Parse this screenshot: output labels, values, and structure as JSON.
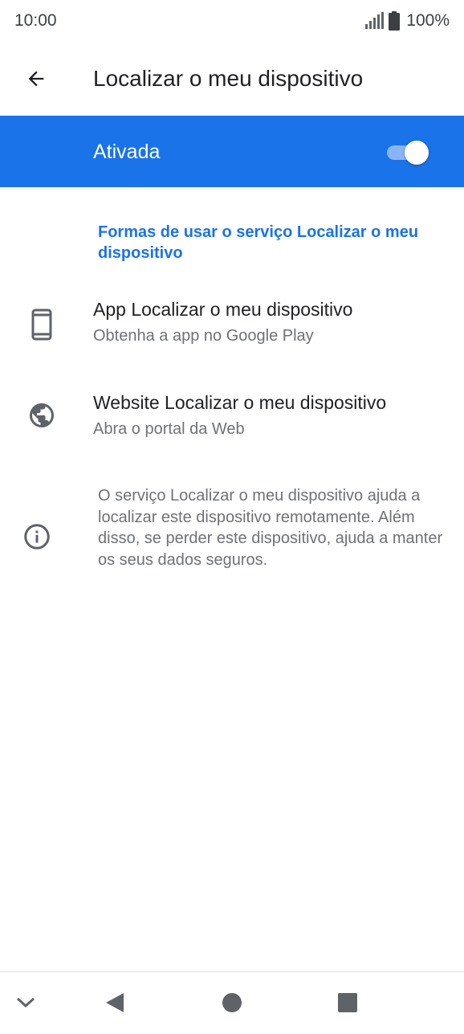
{
  "status_bar": {
    "time": "10:00",
    "battery": "100%",
    "icons": [
      "signal-icon",
      "battery-icon"
    ]
  },
  "toolbar": {
    "back_icon": "arrow-back-icon",
    "title": "Localizar o meu dispositivo"
  },
  "master_switch": {
    "label": "Ativada",
    "checked": true,
    "bar_color": "#1a73e8"
  },
  "section": {
    "header": "Formas de usar o serviço Localizar o meu dispositivo",
    "items": [
      {
        "icon": "phone-icon",
        "title": "App Localizar o meu dispositivo",
        "subtitle": "Obtenha a app no Google Play"
      },
      {
        "icon": "globe-icon",
        "title": "Website Localizar o meu dispositivo",
        "subtitle": "Abra o portal da Web"
      }
    ]
  },
  "footer": {
    "icon": "info-icon",
    "text": "O serviço Localizar o meu dispositivo ajuda a localizar este dispositivo remotamente. Além disso, se perder este dispositivo, ajuda a manter os seus dados seguros."
  },
  "nav_bar": {
    "icons": [
      "chevron-down-icon",
      "nav-back-icon",
      "nav-home-icon",
      "nav-recents-icon"
    ]
  }
}
